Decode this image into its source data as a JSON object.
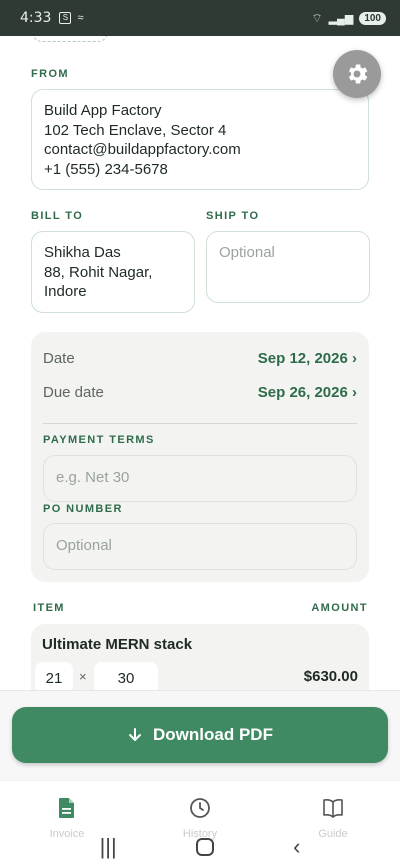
{
  "status": {
    "time": "4:33",
    "battery": "100"
  },
  "from": {
    "label": "FROM",
    "lines": [
      "Build App Factory",
      "102 Tech Enclave, Sector 4",
      "contact@buildappfactory.com",
      "+1 (555) 234-5678"
    ]
  },
  "bill_to": {
    "label": "BILL TO",
    "lines": [
      "Shikha Das",
      "88, Rohit Nagar,",
      "Indore"
    ]
  },
  "ship_to": {
    "label": "SHIP TO",
    "placeholder": "Optional"
  },
  "dates": {
    "date_label": "Date",
    "date_value": "Sep 12, 2026 ›",
    "due_label": "Due date",
    "due_value": "Sep 26, 2026 ›"
  },
  "payment_terms": {
    "label": "PAYMENT TERMS",
    "placeholder": "e.g. Net 30"
  },
  "po_number": {
    "label": "PO NUMBER",
    "placeholder": "Optional"
  },
  "items": {
    "item_header": "ITEM",
    "amount_header": "AMOUNT",
    "rows": [
      {
        "name": "Ultimate MERN stack",
        "qty": "21",
        "times": "×",
        "rate": "30",
        "amount": "$630.00"
      }
    ]
  },
  "download": {
    "label": "Download PDF"
  },
  "tabs": [
    {
      "label": "Invoice",
      "icon": "document-icon",
      "active": true
    },
    {
      "label": "History",
      "icon": "clock-icon",
      "active": false
    },
    {
      "label": "Guide",
      "icon": "book-icon",
      "active": false
    }
  ],
  "colors": {
    "accent": "#3f8a62",
    "label": "#2f6b4b",
    "status_bar": "#2e3a33"
  }
}
